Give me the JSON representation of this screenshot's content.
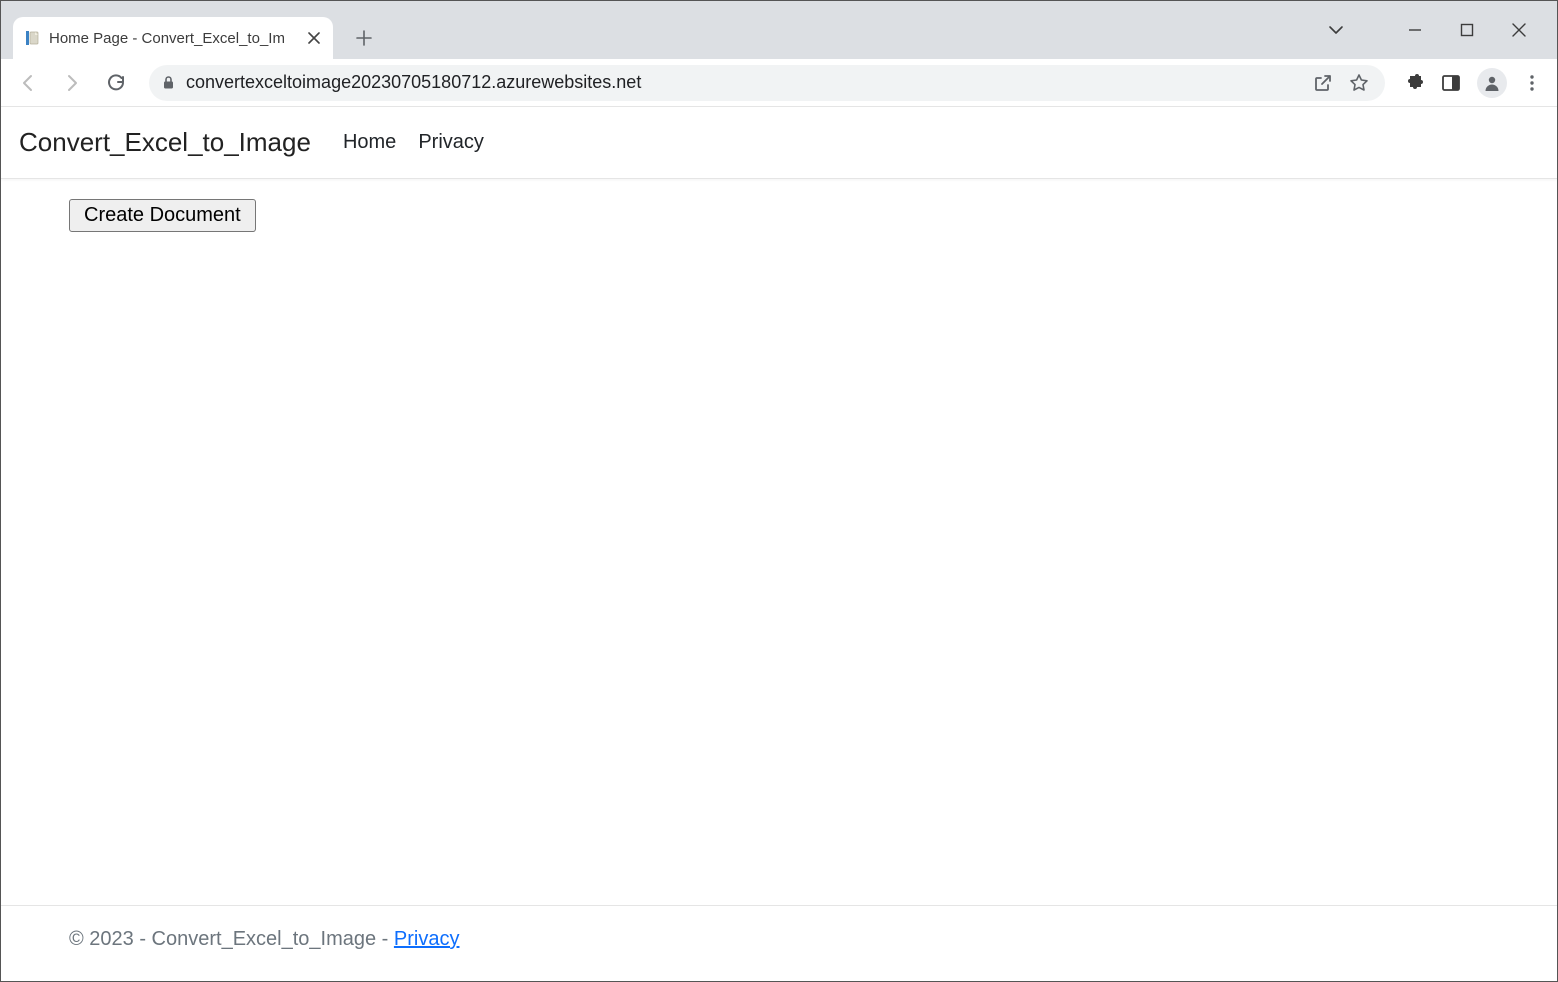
{
  "browser": {
    "tab": {
      "title": "Home Page - Convert_Excel_to_Im"
    },
    "url": "convertexceltoimage20230705180712.azurewebsites.net"
  },
  "page": {
    "brand": "Convert_Excel_to_Image",
    "nav": {
      "home": "Home",
      "privacy": "Privacy"
    },
    "main": {
      "create_button": "Create Document"
    },
    "footer": {
      "text": "© 2023 - Convert_Excel_to_Image - ",
      "privacy_link": "Privacy"
    }
  }
}
